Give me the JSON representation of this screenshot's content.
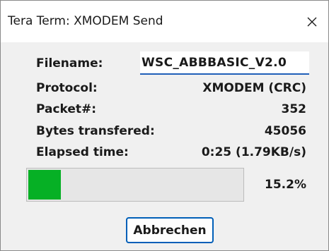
{
  "window": {
    "title": "Tera Term: XMODEM Send"
  },
  "fields": {
    "filename_label": "Filename:",
    "filename_value": "WSC_ABBBASIC_V2.0",
    "protocol_label": "Protocol:",
    "protocol_value": "XMODEM (CRC)",
    "packet_label": "Packet#:",
    "packet_value": "352",
    "bytes_label": "Bytes transfered:",
    "bytes_value": "45056",
    "elapsed_label": "Elapsed time:",
    "elapsed_value": "0:25 (1.79KB/s)"
  },
  "progress": {
    "fraction": 0.152,
    "percent_text": "15.2%",
    "fill_color": "#06b025"
  },
  "buttons": {
    "cancel_label": "Abbrechen"
  },
  "icons": {
    "close": "close-icon"
  }
}
